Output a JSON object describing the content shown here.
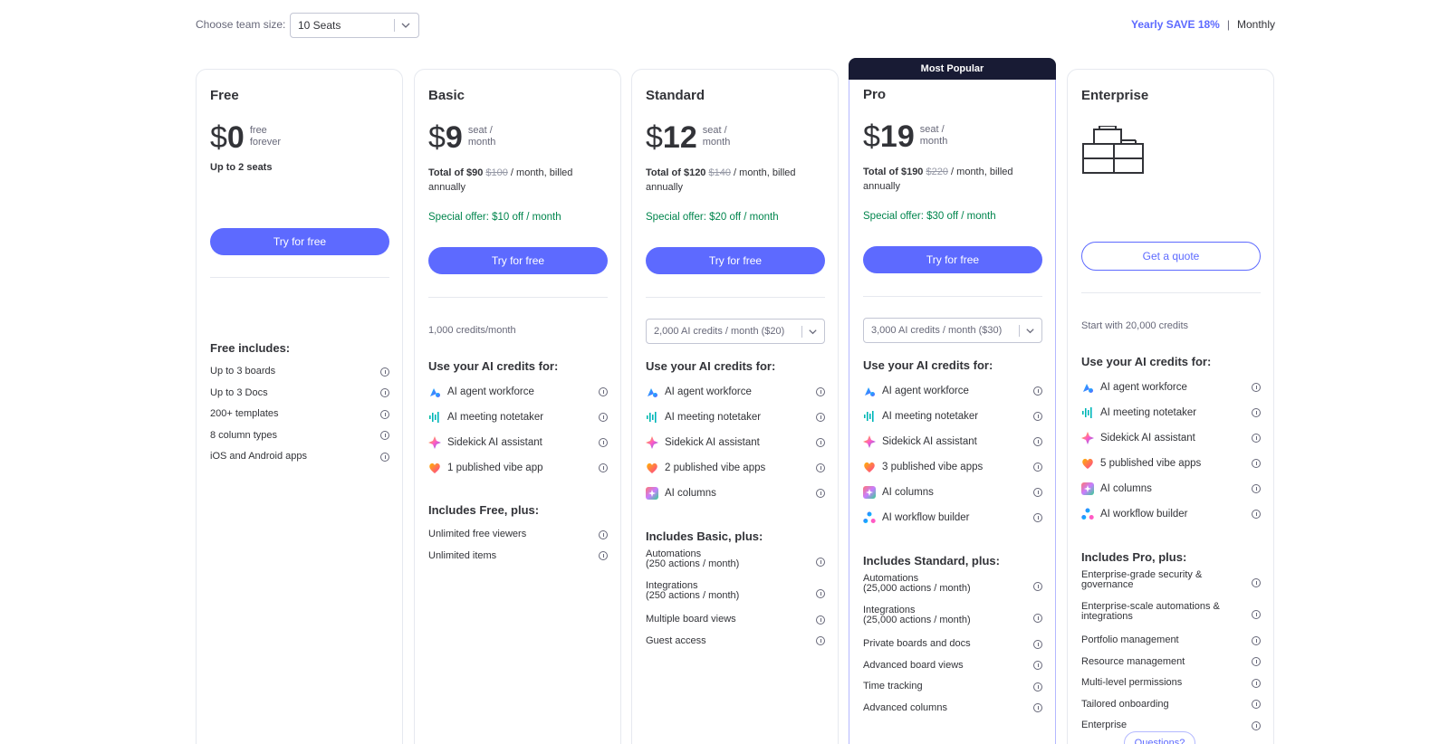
{
  "top": {
    "team_label": "Choose team size:",
    "seat_value": "10 Seats",
    "yearly": "Yearly SAVE 18%",
    "separator": "|",
    "monthly": "Monthly"
  },
  "popular_banner": "Most Popular",
  "ai_heading": "Use your AI credits for:",
  "ai_features": [
    "AI agent workforce",
    "AI meeting notetaker",
    "Sidekick AI assistant",
    "1 published vibe app",
    "2 published vibe apps",
    "3 published vibe apps",
    "5 published vibe apps",
    "AI columns",
    "AI workflow builder"
  ],
  "plans": {
    "free": {
      "name": "Free",
      "currency": "$",
      "amount": "0",
      "per_1": "free",
      "per_2": "forever",
      "seats_note": "Up to 2 seats",
      "button": "Try for free",
      "includes_title": "Free includes:",
      "features": [
        "Up to 3 boards",
        "Up to 3 Docs",
        "200+ templates",
        "8 column types",
        "iOS and Android apps"
      ]
    },
    "basic": {
      "name": "Basic",
      "currency": "$",
      "amount": "9",
      "per_1": "seat /",
      "per_2": "month",
      "total_bold": "Total of $90",
      "total_strike": "$100",
      "total_rest": "/ month, billed annually",
      "offer": "Special offer: $10 off / month",
      "button": "Try for free",
      "credits": "1,000 credits/month",
      "includes_title": "Includes Free, plus:",
      "features": [
        "Unlimited free viewers",
        "Unlimited items"
      ]
    },
    "standard": {
      "name": "Standard",
      "currency": "$",
      "amount": "12",
      "per_1": "seat /",
      "per_2": "month",
      "total_bold": "Total of $120",
      "total_strike": "$140",
      "total_rest": "/ month, billed annually",
      "offer": "Special offer: $20 off / month",
      "button": "Try for free",
      "credits": "2,000 AI credits / month ($20)",
      "includes_title": "Includes Basic, plus:",
      "features": [
        {
          "l1": "Automations",
          "l2": "(250 actions / month)"
        },
        {
          "l1": "Integrations",
          "l2": "(250 actions / month)"
        },
        {
          "l1": "Multiple board views",
          "l2": ""
        },
        {
          "l1": "Guest access",
          "l2": ""
        }
      ]
    },
    "pro": {
      "name": "Pro",
      "currency": "$",
      "amount": "19",
      "per_1": "seat /",
      "per_2": "month",
      "total_bold": "Total of $190",
      "total_strike": "$220",
      "total_rest": "/ month, billed annually",
      "offer": "Special offer: $30 off / month",
      "button": "Try for free",
      "credits": "3,000 AI credits / month ($30)",
      "includes_title": "Includes Standard, plus:",
      "features": [
        {
          "l1": "Automations",
          "l2": "(25,000 actions / month)"
        },
        {
          "l1": "Integrations",
          "l2": "(25,000 actions / month)"
        },
        {
          "l1": "Private boards and docs",
          "l2": ""
        },
        {
          "l1": "Advanced board views",
          "l2": ""
        },
        {
          "l1": "Time tracking",
          "l2": ""
        },
        {
          "l1": "Advanced columns",
          "l2": ""
        }
      ]
    },
    "enterprise": {
      "name": "Enterprise",
      "button": "Get a quote",
      "credits": "Start with 20,000 credits",
      "includes_title": "Includes Pro, plus:",
      "features": [
        {
          "l1": "Enterprise-grade security &",
          "l2": "governance"
        },
        {
          "l1": "Enterprise-scale automations &",
          "l2": "integrations"
        },
        {
          "l1": "Portfolio management",
          "l2": ""
        },
        {
          "l1": "Resource management",
          "l2": ""
        },
        {
          "l1": "Multi-level permissions",
          "l2": ""
        },
        {
          "l1": "Tailored onboarding",
          "l2": ""
        },
        {
          "l1": "Enterprise",
          "l2": ""
        }
      ]
    }
  },
  "questions_button": "Questions?",
  "colors": {
    "accent": "#5d6aff",
    "offer_green": "#00854d",
    "banner_dark": "#181b34",
    "text": "#323338",
    "muted": "#676879"
  }
}
